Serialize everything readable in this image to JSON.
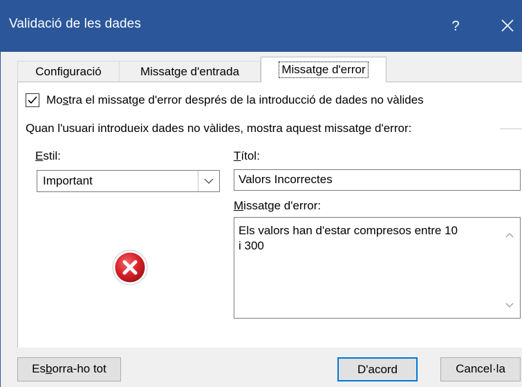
{
  "dialog": {
    "title": "Validació de les dades",
    "help_label": "?"
  },
  "tabs": [
    {
      "label": "Configuració",
      "active": false
    },
    {
      "label": "Missatge d'entrada",
      "active": false
    },
    {
      "label": "Missatge d'error",
      "active": true
    }
  ],
  "error_tab": {
    "show_error_checkbox": {
      "checked": true,
      "label_prefix": "Mo",
      "label_mnemonic": "s",
      "label_suffix": "tra el missatge d'error després de la introducció de dades no vàlides"
    },
    "group_caption": "Quan l'usuari introdueix dades no vàlides, mostra aquest missatge d'error:",
    "style": {
      "label_mnemonic": "E",
      "label_rest": "stil:",
      "value": "Important"
    },
    "title": {
      "label_mnemonic": "T",
      "label_rest": "ítol:",
      "value": "Valors Incorrectes"
    },
    "error_message": {
      "label_mnemonic": "M",
      "label_rest": "issatge d'error:",
      "value": "Els valors han d'estar compresos entre 10\ni 300"
    },
    "icon": "error-circle-x-icon"
  },
  "footer": {
    "clear_all_prefix": "Es",
    "clear_all_mnemonic": "b",
    "clear_all_suffix": "orra-ho tot",
    "ok_label": "D'acord",
    "cancel_label": "Cancel·la"
  },
  "colors": {
    "titlebar": "#2b579a",
    "dialog_bg": "#f0f0f0",
    "default_button_border": "#0078d7",
    "error_icon": "#d9222a"
  }
}
